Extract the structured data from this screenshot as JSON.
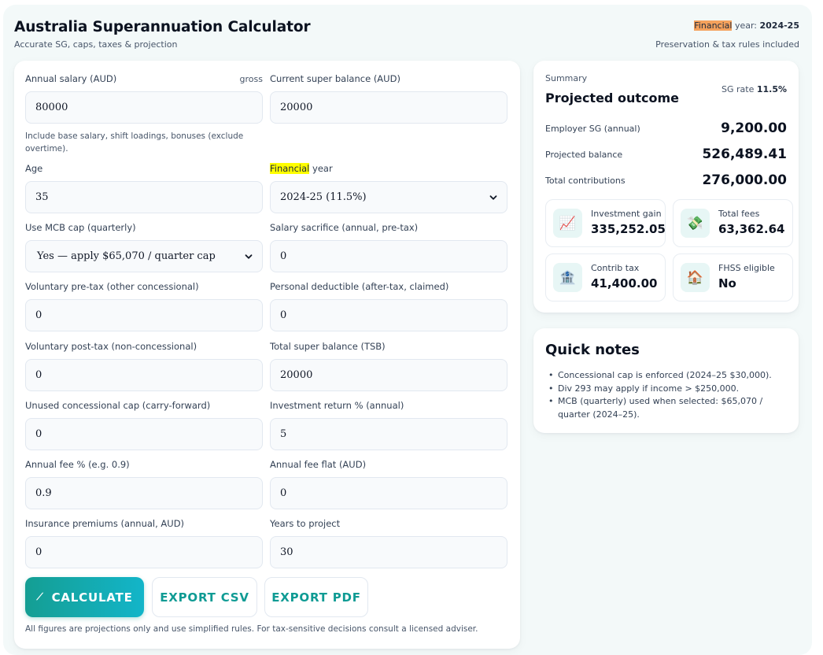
{
  "header": {
    "title": "Australia Superannuation Calculator",
    "subtitle": "Accurate SG, caps, taxes & projection",
    "fy_prefix_highlight": "Financial",
    "fy_rest": " year: ",
    "fy_value": "2024-25",
    "note": "Preservation & tax rules included"
  },
  "form": {
    "salary": {
      "label": "Annual salary (AUD)",
      "suffix": "gross",
      "value": "80000",
      "help": "Include base salary, shift loadings, bonuses (exclude overtime)."
    },
    "current_balance": {
      "label": "Current super balance (AUD)",
      "value": "20000"
    },
    "age": {
      "label": "Age",
      "value": "35"
    },
    "financial_year": {
      "label_highlight": "Financial",
      "label_rest": " year",
      "value": "2024-25 (11.5%)"
    },
    "mcb_cap": {
      "label": "Use MCB cap (quarterly)",
      "value": "Yes — apply $65,070 / quarter cap"
    },
    "salary_sacrifice": {
      "label": "Salary sacrifice (annual, pre-tax)",
      "value": "0"
    },
    "voluntary_pretax": {
      "label": "Voluntary pre-tax (other concessional)",
      "value": "0"
    },
    "personal_deductible": {
      "label": "Personal deductible (after-tax, claimed)",
      "value": "0"
    },
    "voluntary_posttax": {
      "label": "Voluntary post-tax (non-concessional)",
      "value": "0"
    },
    "total_super_balance": {
      "label": "Total super balance (TSB)",
      "value": "20000"
    },
    "unused_cap": {
      "label": "Unused concessional cap (carry-forward)",
      "value": "0"
    },
    "investment_return": {
      "label": "Investment return % (annual)",
      "value": "5"
    },
    "annual_fee_pct": {
      "label": "Annual fee % (e.g. 0.9)",
      "value": "0.9"
    },
    "annual_fee_flat": {
      "label": "Annual fee flat (AUD)",
      "value": "0"
    },
    "insurance": {
      "label": "Insurance premiums (annual, AUD)",
      "value": "0"
    },
    "years": {
      "label": "Years to project",
      "value": "30"
    }
  },
  "actions": {
    "calculate": "CALCULATE",
    "export_csv": "EXPORT CSV",
    "export_pdf": "EXPORT PDF",
    "calculate_icon": "wand-icon"
  },
  "disclaimer": "All figures are projections only and use simplified rules. For tax-sensitive decisions consult a licensed adviser.",
  "summary": {
    "eyebrow": "Summary",
    "title": "Projected outcome",
    "sg_rate_label": "SG rate ",
    "sg_rate_value": "11.5%",
    "rows": [
      {
        "label": "Employer SG (annual)",
        "value": "9,200.00"
      },
      {
        "label": "Projected balance",
        "value": "526,489.41"
      },
      {
        "label": "Total contributions",
        "value": "276,000.00"
      }
    ],
    "tiles": [
      {
        "label": "Investment gain",
        "value": "335,252.05",
        "icon": "chart-increasing-icon",
        "glyph": "📈"
      },
      {
        "label": "Total fees",
        "value": "63,362.64",
        "icon": "money-with-wings-icon",
        "glyph": "💸"
      },
      {
        "label": "Contrib tax",
        "value": "41,400.00",
        "icon": "bank-icon",
        "glyph": "🏦"
      },
      {
        "label": "FHSS eligible",
        "value": "No",
        "icon": "house-icon",
        "glyph": "🏠"
      }
    ]
  },
  "notes": {
    "title": "Quick notes",
    "items": [
      "Concessional cap is enforced (2024–25 $30,000).",
      "Div 293 may apply if income > $250,000.",
      "MCB (quarterly) used when selected: $65,070 / quarter (2024–25)."
    ]
  },
  "colors": {
    "accent": "#0f9b94",
    "gradient_start": "#149e93",
    "gradient_end": "#13b5c9",
    "highlight_orange": "#f5a25d",
    "highlight_yellow": "#ffff00"
  }
}
